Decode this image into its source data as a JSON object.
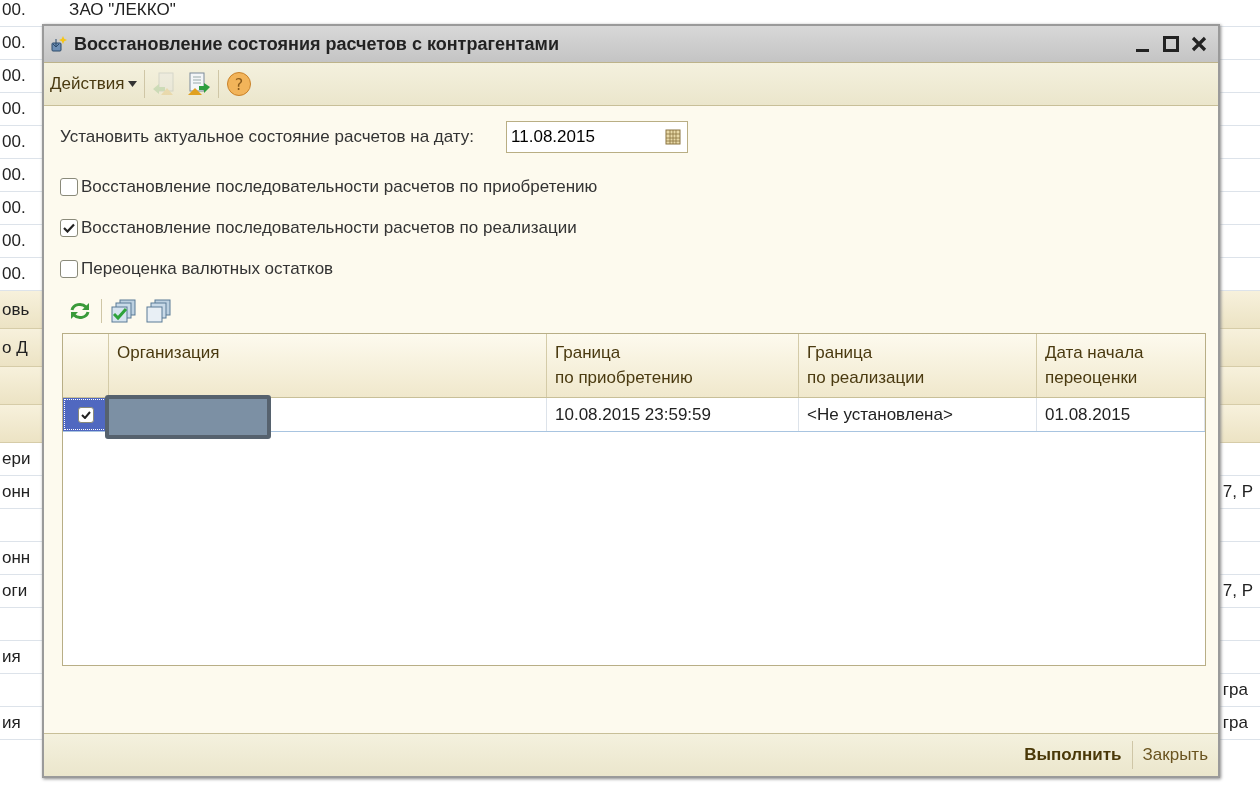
{
  "background_list": {
    "rows": [
      {
        "kind": "row",
        "column_1": "00.",
        "column_2": "ЗАО \"ЛЕККО\""
      },
      {
        "kind": "row",
        "column_1": "00."
      },
      {
        "kind": "row",
        "column_1": "00."
      },
      {
        "kind": "row",
        "column_1": "00."
      },
      {
        "kind": "row",
        "column_1": "00."
      },
      {
        "kind": "row",
        "column_1": "00."
      },
      {
        "kind": "row",
        "column_1": "00."
      },
      {
        "kind": "row",
        "column_1": "00."
      },
      {
        "kind": "row",
        "column_1": "00."
      },
      {
        "kind": "header",
        "column_1": "овь"
      },
      {
        "kind": "header",
        "column_1": "о Д"
      },
      {
        "kind": "header"
      },
      {
        "kind": "header"
      },
      {
        "kind": "row",
        "column_1": "ери"
      },
      {
        "kind": "row",
        "column_1": "онн",
        "column_3": "7, Р"
      },
      {
        "kind": "row"
      },
      {
        "kind": "row",
        "column_1": "онн"
      },
      {
        "kind": "row",
        "column_1": "оги",
        "column_3": "7, Р"
      },
      {
        "kind": "row"
      },
      {
        "kind": "row",
        "column_1": "ия"
      },
      {
        "kind": "row",
        "column_3": "гра"
      },
      {
        "kind": "row",
        "column_1": "ия",
        "column_3": "гра"
      }
    ]
  },
  "window": {
    "title": "Восстановление состояния расчетов с контрагентами",
    "toolbar": {
      "menu": "Действия",
      "buttons": [
        {
          "kind": "doc-left",
          "disabled": true
        },
        {
          "kind": "doc-right",
          "disabled": false
        },
        {
          "kind": "help",
          "disabled": false,
          "glyph": "?"
        }
      ]
    },
    "date_label": "Установить актуальное состояние расчетов на дату:",
    "date_field": {
      "value": "11.08.2015"
    },
    "options": [
      {
        "label": "Восстановление последовательности расчетов по приобретению",
        "checked": false
      },
      {
        "label": "Восстановление последовательности расчетов по реализации",
        "checked": true
      },
      {
        "label": "Переоценка валютных остатков",
        "checked": false
      }
    ],
    "table_toolbar": [
      {
        "kind": "refresh"
      },
      {
        "kind": "check-all"
      },
      {
        "kind": "uncheck-all"
      }
    ],
    "table": {
      "columns": [
        "Организация",
        "Граница\nпо приобретению",
        "Граница\nпо реализации",
        "Дата начала\nпереоценки"
      ],
      "rows": [
        {
          "selected": true,
          "checked": true,
          "redacted": true,
          "cells": [
            "",
            "10.08.2015 23:59:59",
            "<Не установлена>",
            "01.08.2015"
          ]
        }
      ]
    },
    "buttons": [
      {
        "label": "Выполнить",
        "default": true
      },
      {
        "label": "Закрыть",
        "default": false
      }
    ]
  }
}
